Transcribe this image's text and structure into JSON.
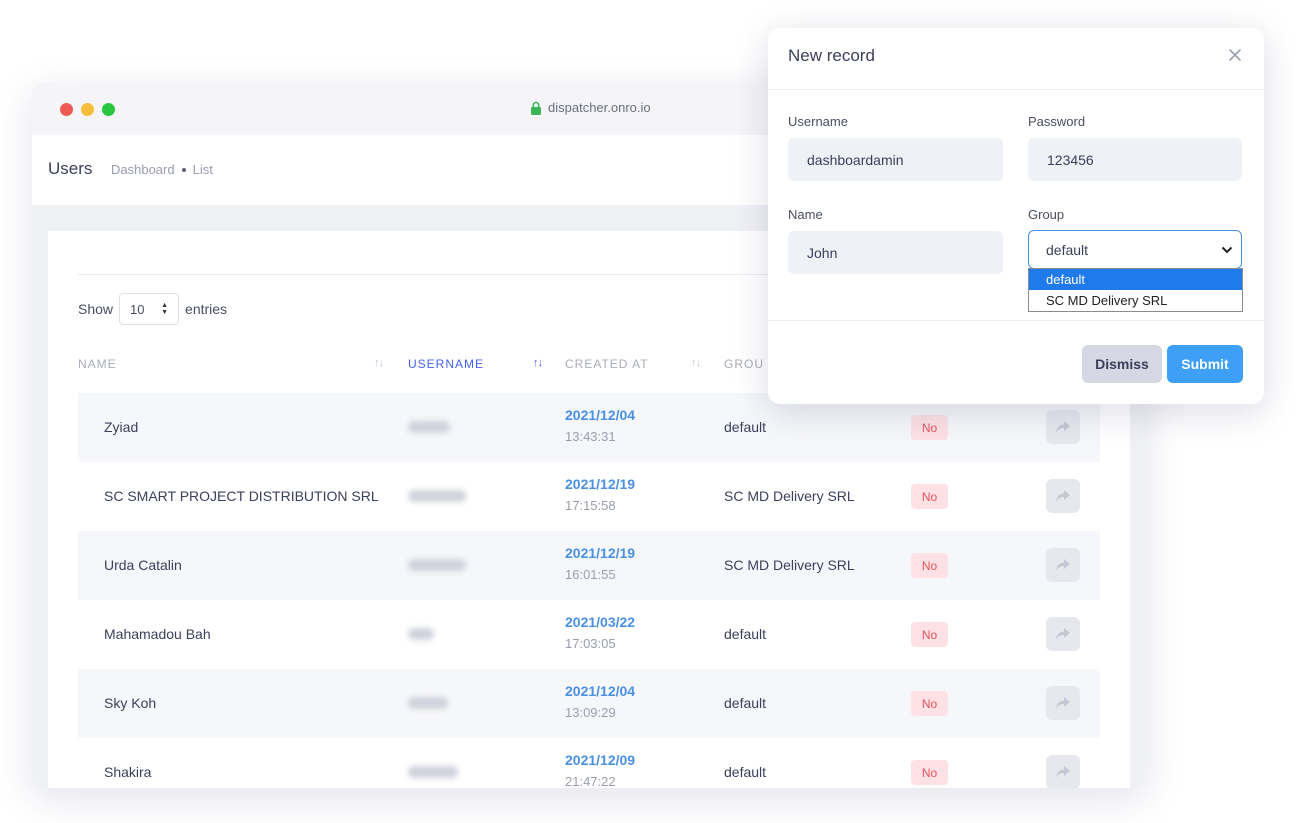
{
  "browser": {
    "url": "dispatcher.onro.io"
  },
  "header": {
    "title": "Users",
    "breadcrumb": [
      "Dashboard",
      "List"
    ]
  },
  "table": {
    "show_label": "Show",
    "entries_value": "10",
    "entries_label": "entries",
    "columns": [
      "NAME",
      "USERNAME",
      "CREATED AT",
      "GROU"
    ],
    "sorted_column": "USERNAME",
    "rows": [
      {
        "name": "Zyiad",
        "date": "2021/12/04",
        "time": "13:43:31",
        "group": "default",
        "status": "No"
      },
      {
        "name": "SC SMART PROJECT DISTRIBUTION SRL",
        "date": "2021/12/19",
        "time": "17:15:58",
        "group": "SC MD Delivery SRL",
        "status": "No"
      },
      {
        "name": "Urda Catalin",
        "date": "2021/12/19",
        "time": "16:01:55",
        "group": "SC MD Delivery SRL",
        "status": "No"
      },
      {
        "name": "Mahamadou Bah",
        "date": "2021/03/22",
        "time": "17:03:05",
        "group": "default",
        "status": "No"
      },
      {
        "name": "Sky Koh",
        "date": "2021/12/04",
        "time": "13:09:29",
        "group": "default",
        "status": "No"
      },
      {
        "name": "Shakira",
        "date": "2021/12/09",
        "time": "21:47:22",
        "group": "default",
        "status": "No"
      }
    ]
  },
  "modal": {
    "title": "New record",
    "username_label": "Username",
    "username_value": "dashboardamin",
    "password_label": "Password",
    "password_value": "123456",
    "name_label": "Name",
    "name_value": "John",
    "group_label": "Group",
    "group_value": "default",
    "group_options": [
      "default",
      "SC MD Delivery SRL"
    ],
    "dismiss_label": "Dismiss",
    "submit_label": "Submit"
  },
  "colors": {
    "accent": "#4361ee",
    "date_blue": "#4a90e2",
    "submit_blue": "#3d9ff5",
    "badge_red": "#e7515a",
    "badge_bg": "#fde1e5"
  },
  "icons": [
    "lock-icon",
    "close-icon",
    "chevron-down-icon",
    "share-icon",
    "sort-icon"
  ]
}
